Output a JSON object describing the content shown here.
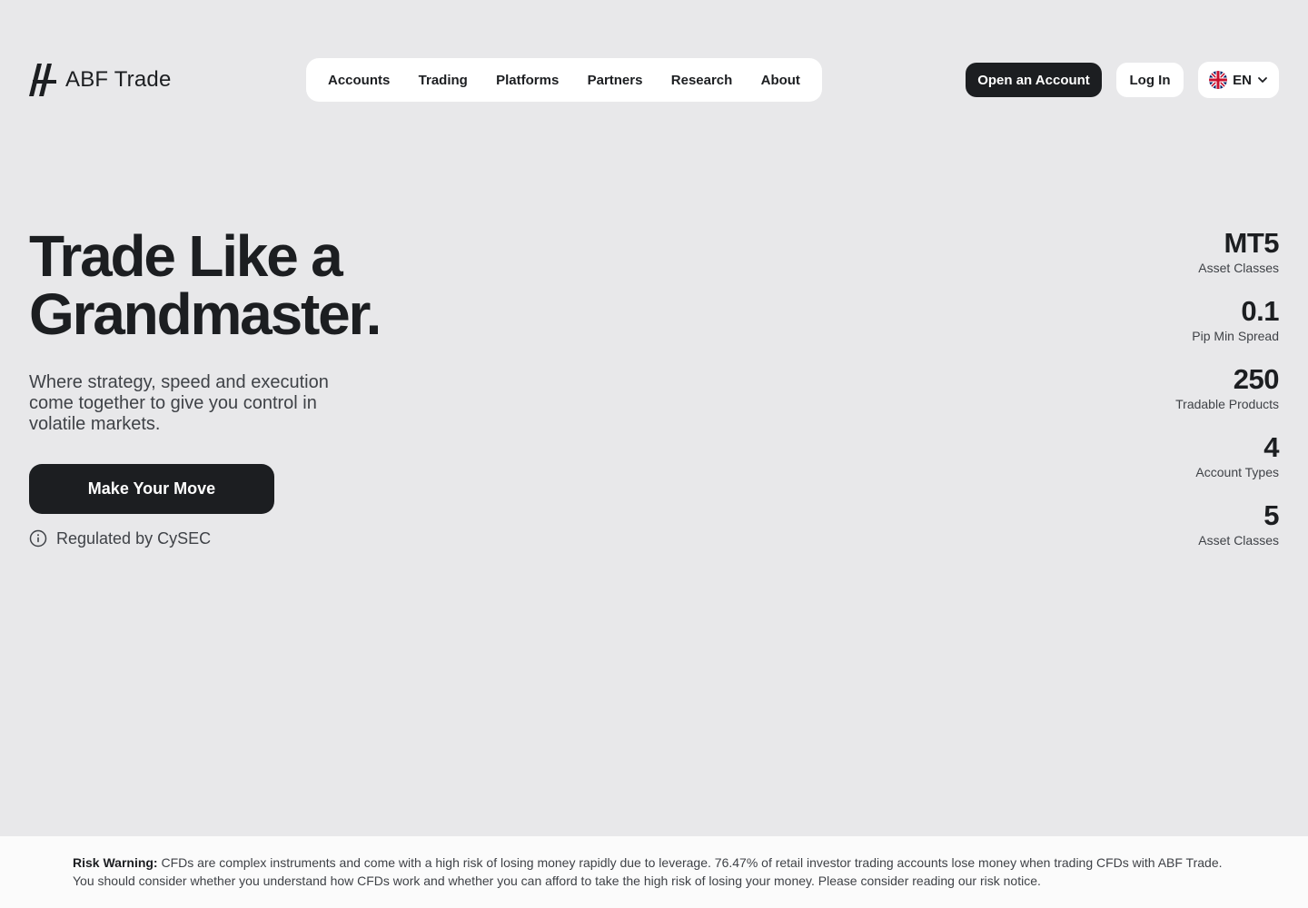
{
  "brand": {
    "name": "ABF Trade",
    "logo_icon": "abf-slash-logo-icon"
  },
  "nav": {
    "items": [
      {
        "label": "Accounts"
      },
      {
        "label": "Trading"
      },
      {
        "label": "Platforms"
      },
      {
        "label": "Partners"
      },
      {
        "label": "Research"
      },
      {
        "label": "About"
      }
    ]
  },
  "header": {
    "open_account_label": "Open an Account",
    "login_label": "Log In",
    "language": {
      "code": "EN",
      "flag_icon": "uk-flag-icon",
      "chevron_icon": "chevron-down-icon"
    }
  },
  "hero": {
    "title_line1": "Trade Like a",
    "title_line2": "Grandmaster.",
    "subtitle": "Where strategy, speed and execution come together to give you control in volatile markets.",
    "cta_label": "Make Your Move",
    "regulated_label": "Regulated by CySEC",
    "regulated_icon": "info-circle-icon"
  },
  "stats": [
    {
      "value": "MT5",
      "label": "Asset Classes"
    },
    {
      "value": "0.1",
      "label": "Pip Min Spread"
    },
    {
      "value": "250",
      "label": "Tradable Products"
    },
    {
      "value": "4",
      "label": "Account Types"
    },
    {
      "value": "5",
      "label": "Asset Classes"
    }
  ],
  "risk": {
    "title": "Risk Warning:",
    "text_line1": "CFDs are complex instruments and come with a high risk of losing money rapidly due to leverage. 76.47% of retail investor trading accounts lose money when trading CFDs with ABF Trade.",
    "text_line2": "You should consider whether you understand how CFDs work and whether you can afford to take the high risk of losing your money. Please consider reading our risk notice."
  },
  "colors": {
    "background": "#e8e8ea",
    "primary_dark": "#1c1e21",
    "surface": "#ffffff",
    "muted_text": "#3f4247"
  }
}
